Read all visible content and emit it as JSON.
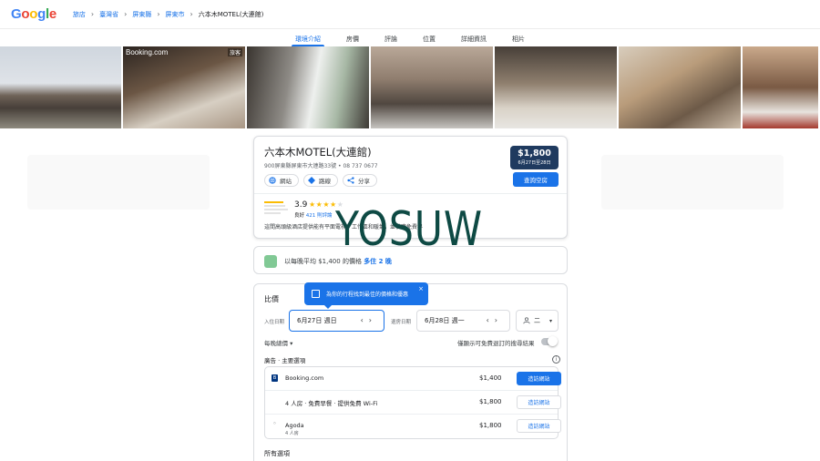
{
  "logo": {
    "text": "Google",
    "colors": [
      "#4285f4",
      "#ea4335",
      "#fbbc05",
      "#4285f4",
      "#34a853",
      "#ea4335"
    ]
  },
  "breadcrumbs": [
    "旅店",
    "臺灣省",
    "屏東縣",
    "屏東市",
    "六本木MOTEL(大連館)"
  ],
  "tabs": [
    "環境介紹",
    "房價",
    "評論",
    "位置",
    "詳細資訊",
    "相片"
  ],
  "active_tab": "環境介紹",
  "photos": {
    "booking_label": "Booking.com",
    "badge_label": "旅客"
  },
  "hotel": {
    "name": "六本木MOTEL(大連館)",
    "address": "900屏東縣屏東市大連路33號 • 08 737 0677",
    "chips": {
      "website": "網站",
      "directions": "路線",
      "share": "分享"
    },
    "price": "$1,800",
    "price_dates": "6月27日至28日",
    "check_button": "查詢空房",
    "rating": "3.9",
    "stars_filled": 4,
    "rating_label": "良好",
    "reviews_link": "421 則評論",
    "description": "這間高頭級酒店提供能有平面電視。工作區和暖氣，並供應免費早"
  },
  "deal": {
    "text_prefix": "以每晚平均 $1,400 的價格",
    "text_bold": "多住 2 晚"
  },
  "compare": {
    "title": "比價",
    "tooltip": "為你的行程找到最佳的價格和優惠",
    "checkin_label": "入住日期",
    "checkin_value": "6月27日 週日",
    "checkout_label": "退房日期",
    "checkout_value": "6月28日 週一",
    "guests": "二",
    "per_night": "每晚總價",
    "toggle_label": "僅顯示可免費退訂的搜尋結果",
    "section_head": "廣告 · 主要選項",
    "info": "i",
    "offers": [
      {
        "icon": "B",
        "provider": "Booking.com",
        "sub": "",
        "price": "$1,400",
        "button": "造訪網站",
        "primary": true
      },
      {
        "icon": "",
        "provider": "4 人房 · 免費早餐 · 提供免費 Wi-Fi",
        "sub": "",
        "price": "$1,800",
        "button": "造訪網站",
        "primary": false
      },
      {
        "icon": "G",
        "provider": "Agoda",
        "sub": "4 人房",
        "price": "$1,800",
        "button": "造訪網站",
        "primary": false
      }
    ],
    "all_options": "所有選項"
  },
  "watermark": "YOSUW"
}
